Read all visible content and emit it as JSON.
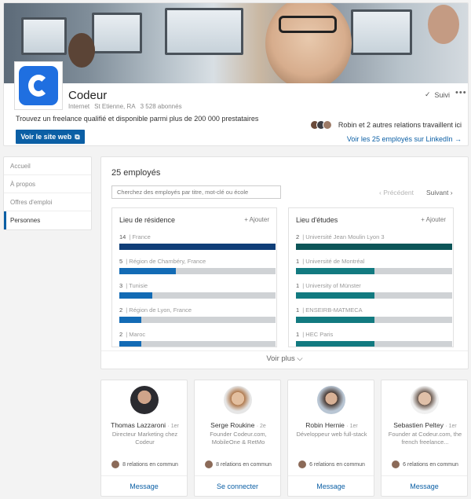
{
  "company": {
    "name": "Codeur",
    "industry": "Internet",
    "location": "St Etienne, RA",
    "followers": "3 528 abonnés",
    "tagline": "Trouvez un freelance qualifié et disponible parmi plus de 200 000 prestataires",
    "website_label": "Voir le site web",
    "follow_label": "Suivi",
    "relations_text": "Robin et 2 autres relations travaillent ici",
    "employees_link": "Voir les 25 employés sur LinkedIn →"
  },
  "nav": {
    "items": [
      "Accueil",
      "À propos",
      "Offres d'emploi",
      "Personnes"
    ],
    "active": "Personnes"
  },
  "employees": {
    "title": "25 employés",
    "search_placeholder": "Cherchez des employés par titre, mot-clé ou école",
    "prev_label": "‹  Précédent",
    "next_label": "Suivant  ›",
    "see_more": "Voir plus ⌵",
    "residence": {
      "title": "Lieu de résidence",
      "add_label": "+  Ajouter",
      "color": "#0f3e78",
      "accent_color": "#136bb5",
      "rows": [
        {
          "count": "14",
          "label": "France",
          "fraction": 1.0
        },
        {
          "count": "5",
          "label": "Région de Chambéry, France",
          "fraction": 0.36
        },
        {
          "count": "3",
          "label": "Tunisie",
          "fraction": 0.21
        },
        {
          "count": "2",
          "label": "Région de Lyon, France",
          "fraction": 0.14
        },
        {
          "count": "2",
          "label": "Maroc",
          "fraction": 0.14
        }
      ]
    },
    "studies": {
      "title": "Lieu d'études",
      "add_label": "+  Ajouter",
      "color": "#0c5558",
      "accent_color": "#127a80",
      "rows": [
        {
          "count": "2",
          "label": "Université Jean Moulin Lyon 3",
          "fraction": 1.0
        },
        {
          "count": "1",
          "label": "Université de Montréal",
          "fraction": 0.5
        },
        {
          "count": "1",
          "label": "University of Münster",
          "fraction": 0.5
        },
        {
          "count": "1",
          "label": "ENSEIRB-MATMECA",
          "fraction": 0.5
        },
        {
          "count": "1",
          "label": "HEC Paris",
          "fraction": 0.5
        }
      ]
    }
  },
  "people": [
    {
      "name": "Thomas Lazzaroni",
      "degree": "· 1er",
      "headline": "Directeur Marketing chez Codeur",
      "common": "8 relations en commun",
      "action": "Message"
    },
    {
      "name": "Serge Roukine",
      "degree": "· 2e",
      "headline": "Founder Codeur.com, MobileOne & RetMo",
      "common": "8 relations en commun",
      "action": "Se connecter"
    },
    {
      "name": "Robin Hernie",
      "degree": "· 1er",
      "headline": "Développeur web full-stack",
      "common": "6 relations en commun",
      "action": "Message"
    },
    {
      "name": "Sebastien Peltey",
      "degree": "· 1er",
      "headline": "Founder at Codeur.com, the french freelance...",
      "common": "6 relations en commun",
      "action": "Message"
    }
  ]
}
